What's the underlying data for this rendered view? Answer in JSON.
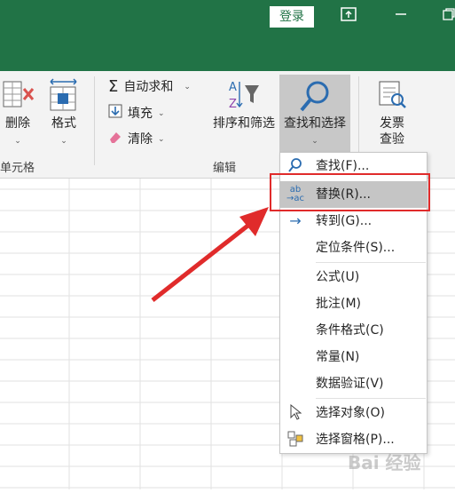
{
  "titlebar": {
    "login_label": "登录"
  },
  "ribbon": {
    "cells_group": {
      "delete_label": "删除",
      "format_label": "格式",
      "group_label": "单元格"
    },
    "editing_group": {
      "autosum_label": "自动求和",
      "fill_label": "填充",
      "clear_label": "清除",
      "sort_filter_label": "排序和筛选",
      "find_select_label": "查找和选择",
      "group_label": "编辑"
    },
    "invoice_group": {
      "label_line1": "发票",
      "label_line2": "查验"
    }
  },
  "menu": {
    "items": [
      {
        "label": "查找(F)...",
        "icon": "search-icon"
      },
      {
        "label": "替换(R)...",
        "icon": "replace-icon",
        "highlighted": true
      },
      {
        "label": "转到(G)...",
        "icon": "arrow-right-icon"
      },
      {
        "label": "定位条件(S)..."
      },
      {
        "label": "公式(U)"
      },
      {
        "label": "批注(M)"
      },
      {
        "label": "条件格式(C)"
      },
      {
        "label": "常量(N)"
      },
      {
        "label": "数据验证(V)"
      },
      {
        "label": "选择对象(O)",
        "icon": "pointer-icon"
      },
      {
        "label": "选择窗格(P)...",
        "icon": "selection-pane-icon"
      }
    ]
  },
  "watermark": "Bai 经验",
  "colors": {
    "titlebar": "#217346",
    "annotation": "#e02b2b",
    "highlight": "#c5c5c5"
  }
}
